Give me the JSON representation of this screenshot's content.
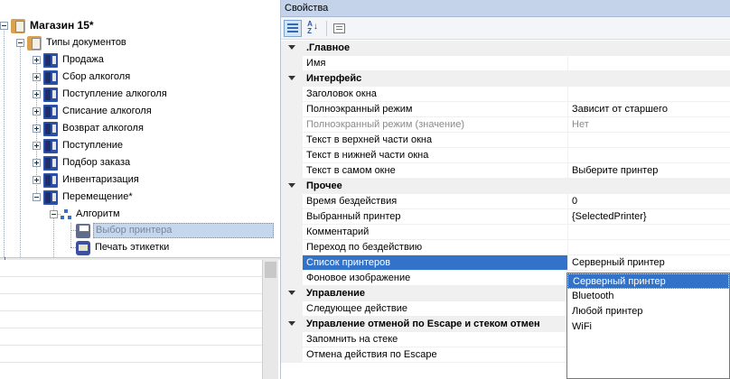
{
  "tree": {
    "root": "Магазин 15*",
    "doc_types": "Типы документов",
    "documents": [
      "Продажа",
      "Сбор алкоголя",
      "Поступление алкоголя",
      "Списание алкоголя",
      "Возврат алкоголя",
      "Поступление",
      "Подбор заказа",
      "Инвентаризация",
      "Перемещение*"
    ],
    "algorithm": "Алгоритм",
    "steps": [
      "Выбор принтера",
      "Печать этикетки"
    ]
  },
  "properties": {
    "title": "Свойства",
    "toolbar": {
      "categorized_icon": "categorized-icon",
      "alphabetical_icon": "alphabetical-sort-icon",
      "property_pages_icon": "property-pages-icon"
    },
    "sections": [
      {
        "name": ".Главное",
        "rows": [
          {
            "name": "Имя",
            "value": ""
          }
        ]
      },
      {
        "name": "Интерфейс",
        "rows": [
          {
            "name": "Заголовок окна",
            "value": ""
          },
          {
            "name": "Полноэкранный режим",
            "value": "Зависит от старшего"
          },
          {
            "name": "Полноэкранный режим (значение)",
            "value": "Нет"
          },
          {
            "name": "Текст в верхней части окна",
            "value": ""
          },
          {
            "name": "Текст в нижней части окна",
            "value": ""
          },
          {
            "name": "Текст в самом окне",
            "value": "Выберите принтер"
          }
        ]
      },
      {
        "name": "Прочее",
        "rows": [
          {
            "name": "Время бездействия",
            "value": "0"
          },
          {
            "name": "Выбранный принтер",
            "value": "{SelectedPrinter}"
          },
          {
            "name": "Комментарий",
            "value": ""
          },
          {
            "name": "Переход по бездействию",
            "value": ""
          },
          {
            "name": "Список принтеров",
            "value": "Серверный принтер"
          },
          {
            "name": "Фоновое изображение",
            "value": ""
          }
        ]
      },
      {
        "name": "Управление",
        "rows": [
          {
            "name": "Следующее действие",
            "value": ""
          }
        ]
      },
      {
        "name": "Управление отменой по Escape и стеком отмен",
        "rows": [
          {
            "name": "Запомнить на стеке",
            "value": ""
          },
          {
            "name": "Отмена действия по Escape",
            "value": ""
          }
        ]
      }
    ],
    "dropdown": {
      "options": [
        "Серверный принтер",
        "Bluetooth",
        "Любой принтер",
        "WiFi"
      ],
      "highlighted": "Серверный принтер"
    }
  },
  "colors": {
    "selection": "#3272c8",
    "title_bar": "#c4d3ea",
    "category_bg": "#f0f0f0"
  }
}
